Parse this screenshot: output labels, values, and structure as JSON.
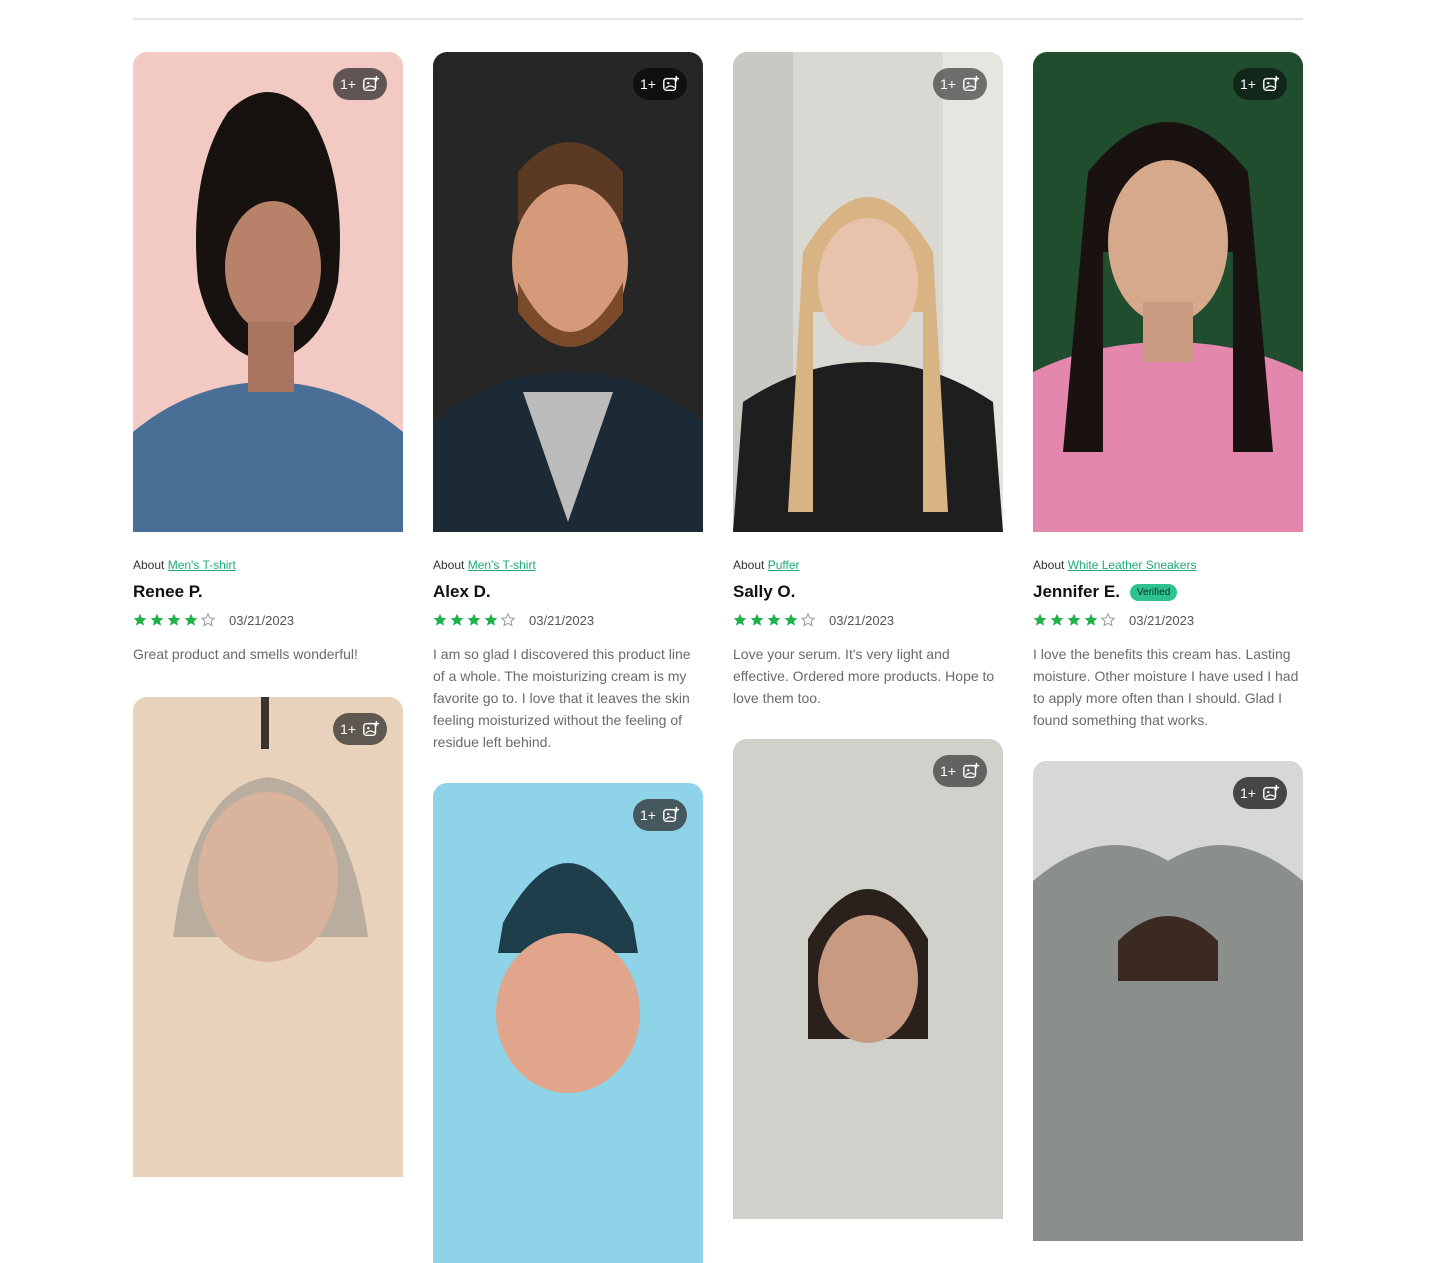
{
  "reviews": [
    {
      "about_prefix": "About",
      "product": "Men's T-shirt",
      "name": "Renee P.",
      "rating": 4,
      "date": "03/21/2023",
      "text": "Great product and smells wonderful!",
      "photo_count": "1+",
      "photo_bg": "#f3c9c4",
      "verified": ""
    },
    {
      "about_prefix": "About",
      "product": "Men's T-shirt",
      "name": "Alex D.",
      "rating": 4,
      "date": "03/21/2023",
      "text": "I am so glad I discovered this product line of a whole. The moisturizing cream is my favorite go to. I love that it leaves the skin feeling moisturized without the feeling of residue left behind.",
      "photo_count": "1+",
      "photo_bg": "#262626",
      "verified": ""
    },
    {
      "about_prefix": "About",
      "product": "Puffer",
      "name": "Sally O.",
      "rating": 4,
      "date": "03/21/2023",
      "text": "Love your serum. It's very light and effective. Ordered more products. Hope to love them too.",
      "photo_count": "1+",
      "photo_bg": "#d9d8d2",
      "verified": ""
    },
    {
      "about_prefix": "About",
      "product": "White Leather Sneakers",
      "name": "Jennifer E.",
      "rating": 4,
      "date": "03/21/2023",
      "text": "I love the benefits this cream has. Lasting moisture. Other moisture I have used I had to apply more often than I should. Glad I found something that works.",
      "photo_count": "1+",
      "photo_bg": "#1f4d2e",
      "verified": "Verified"
    }
  ],
  "next_cards": [
    {
      "photo_count": "1+",
      "photo_bg": "#c8b8a8"
    },
    {
      "photo_count": "1+",
      "photo_bg": "#8fd3e8"
    },
    {
      "photo_count": "1+",
      "photo_bg": "#cfd1ca"
    },
    {
      "photo_count": "1+",
      "photo_bg": "#8a8f8c"
    }
  ],
  "colors": {
    "star": "#20b14a",
    "star_empty": "#9a9a9a",
    "link": "#1fa87a",
    "verified_bg": "#2ec28e"
  }
}
